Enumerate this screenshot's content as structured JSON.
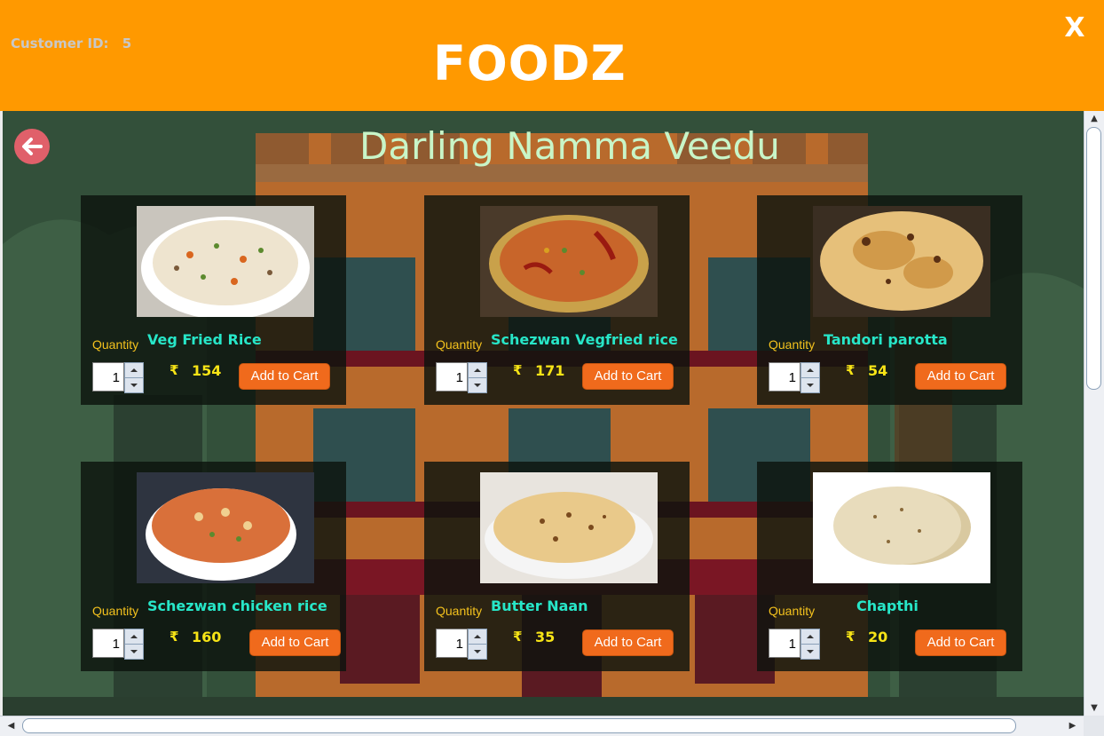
{
  "header": {
    "customer_label": "Customer ID:",
    "customer_id": "5",
    "app_title": "FOODZ",
    "close_label": "X"
  },
  "restaurant": {
    "name": "Darling Namma Veedu"
  },
  "items": [
    {
      "name": "Veg Fried Rice",
      "quantity_label": "Quantity",
      "quantity": "1",
      "currency": "₹",
      "price": "154",
      "button": "Add to Cart"
    },
    {
      "name": "Schezwan Vegfried rice",
      "quantity_label": "Quantity",
      "quantity": "1",
      "currency": "₹",
      "price": "171",
      "button": "Add to Cart"
    },
    {
      "name": "Tandori parotta",
      "quantity_label": "Quantity",
      "quantity": "1",
      "currency": "₹",
      "price": "54",
      "button": "Add to Cart"
    },
    {
      "name": "Schezwan chicken rice",
      "quantity_label": "Quantity",
      "quantity": "1",
      "currency": "₹",
      "price": "160",
      "button": "Add to Cart"
    },
    {
      "name": "Butter Naan",
      "quantity_label": "Quantity",
      "quantity": "1",
      "currency": "₹",
      "price": "35",
      "button": "Add to Cart"
    },
    {
      "name": "Chapthi",
      "quantity_label": "Quantity",
      "quantity": "1",
      "currency": "₹",
      "price": "20",
      "button": "Add to Cart"
    }
  ],
  "colors": {
    "header_bg": "#ff9900",
    "title_text": "#c8f5c8",
    "item_name": "#27e6c8",
    "price": "#f7e416",
    "button_bg": "#f06a1c"
  },
  "icons": {
    "back": "arrow-left-icon",
    "close": "close-icon",
    "spinner_up": "chevron-up-icon",
    "spinner_down": "chevron-down-icon"
  }
}
